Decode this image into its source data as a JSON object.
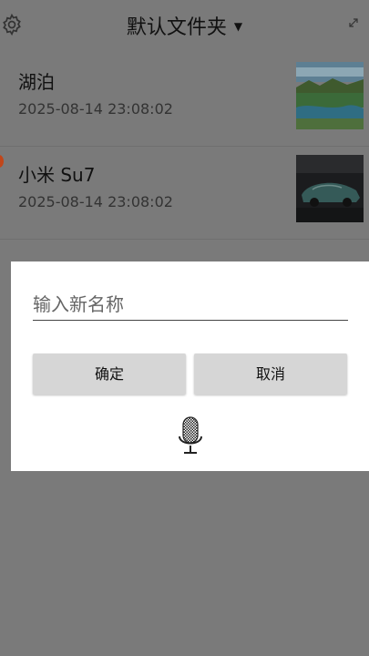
{
  "header": {
    "title": "默认文件夹",
    "icons": {
      "settings": "gear-icon",
      "dropdown": "caret-down-icon",
      "expand": "expand-icon"
    }
  },
  "list": {
    "items": [
      {
        "title": "湖泊",
        "date": "2025-08-14 23:08:02",
        "thumb": "lake-thumbnail"
      },
      {
        "title": "小米 Su7",
        "date": "2025-08-14 23:08:02",
        "thumb": "car-thumbnail"
      }
    ]
  },
  "dialog": {
    "input_placeholder": "输入新名称",
    "input_value": "",
    "confirm_label": "确定",
    "cancel_label": "取消",
    "mic_icon": "microphone-icon"
  },
  "colors": {
    "overlay": "#7a7a7a",
    "dialog_bg": "#ffffff",
    "button_bg": "#d6d6d6",
    "badge": "#c1461a"
  }
}
